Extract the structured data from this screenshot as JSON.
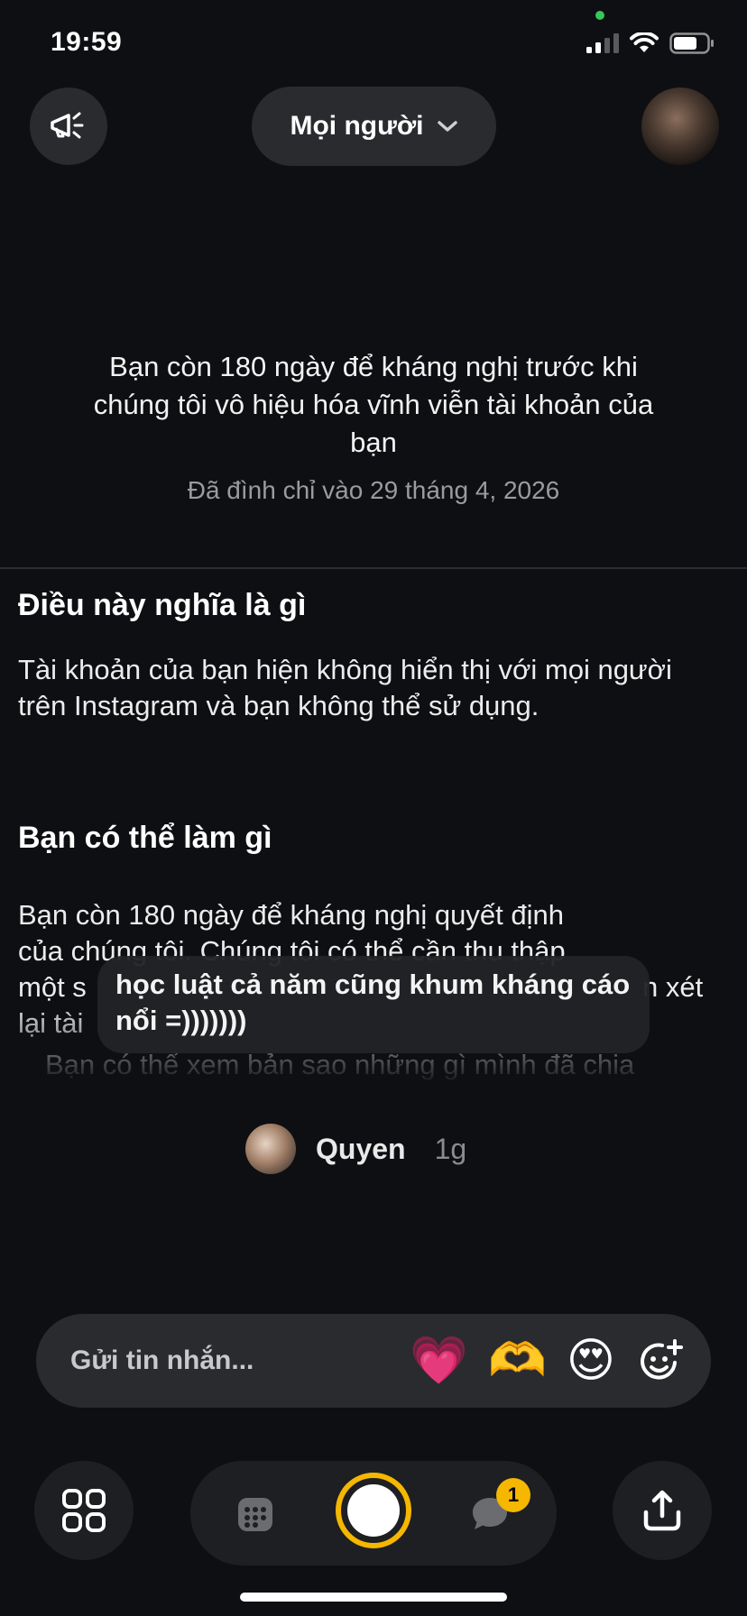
{
  "status_bar": {
    "time": "19:59"
  },
  "header": {
    "audience_label": "Mọi người"
  },
  "suspension": {
    "message": "Bạn còn 180 ngày để kháng nghị trước khi chúng tôi vô hiệu hóa vĩnh viễn tài khoản của bạn",
    "date": "Đã đình chỉ vào 29 tháng 4, 2026"
  },
  "sections": [
    {
      "heading": "Điều này nghĩa là gì",
      "body": "Tài khoản của bạn hiện không hiển thị với mọi người trên Instagram và bạn không thể sử dụng."
    },
    {
      "heading": "Bạn có thể làm gì",
      "body_lines": [
        "Bạn còn 180 ngày để kháng nghị quyết định",
        "của chúng tôi. Chúng tôi có thể cần thu thập",
        "một s",
        "n xét",
        "lại tài",
        "Bạn có thể xem bản sao những gì mình đã chia"
      ]
    }
  ],
  "overlay_caption": "học luật cả năm cũng khum kháng cáo nổi =)))))))",
  "post": {
    "author": "Quyen",
    "time": "1g"
  },
  "message_bar": {
    "placeholder": "Gửi tin nhắn...",
    "reactions": [
      "💗",
      "🫶",
      "😍"
    ]
  },
  "bottom_nav": {
    "chat_badge": "1"
  },
  "colors": {
    "accent": "#f5b700",
    "background": "#0e0f12",
    "surface": "#2a2b2e"
  }
}
